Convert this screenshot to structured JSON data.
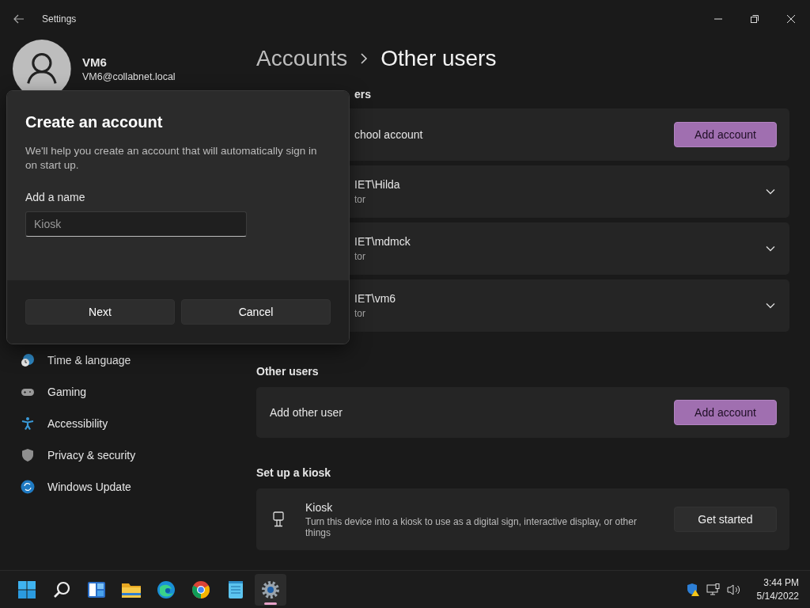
{
  "window": {
    "title": "Settings"
  },
  "profile": {
    "name": "VM6",
    "email": "VM6@collabnet.local"
  },
  "nav": [
    {
      "label": "Time & language",
      "kind": "time"
    },
    {
      "label": "Gaming",
      "kind": "gaming"
    },
    {
      "label": "Accessibility",
      "kind": "accessibility"
    },
    {
      "label": "Privacy & security",
      "kind": "privacy"
    },
    {
      "label": "Windows Update",
      "kind": "update"
    }
  ],
  "breadcrumb": {
    "parent": "Accounts",
    "current": "Other users"
  },
  "family": {
    "heading": "ers",
    "account_row": {
      "label": "chool account",
      "button": "Add account"
    },
    "users": [
      {
        "name": "IET\\Hilda",
        "role": "tor",
        "expanded": false
      },
      {
        "name": "IET\\mdmck",
        "role": "tor",
        "expanded": false
      },
      {
        "name": "IET\\vm6",
        "role": "tor",
        "expanded": false
      }
    ]
  },
  "other_users": {
    "heading": "Other users",
    "label": "Add other user",
    "button": "Add account"
  },
  "kiosk": {
    "heading": "Set up a kiosk",
    "title": "Kiosk",
    "description": "Turn this device into a kiosk to use as a digital sign, interactive display, or other things",
    "button": "Get started"
  },
  "dialog": {
    "title": "Create an account",
    "description": "We'll help you create an account that will automatically sign in on start up.",
    "field_label": "Add a name",
    "placeholder": "Kiosk",
    "buttons": [
      "Next",
      "Cancel"
    ]
  },
  "taskbar": {
    "apps": [
      {
        "kind": "start",
        "active": false
      },
      {
        "kind": "search",
        "active": false
      },
      {
        "kind": "widgets",
        "active": false
      },
      {
        "kind": "folder",
        "active": false
      },
      {
        "kind": "edge",
        "active": false
      },
      {
        "kind": "chrome",
        "active": false
      },
      {
        "kind": "notepad",
        "active": false
      },
      {
        "kind": "settings",
        "active": true
      }
    ],
    "clock": {
      "time": "3:44 PM",
      "date": "5/14/2022"
    }
  }
}
